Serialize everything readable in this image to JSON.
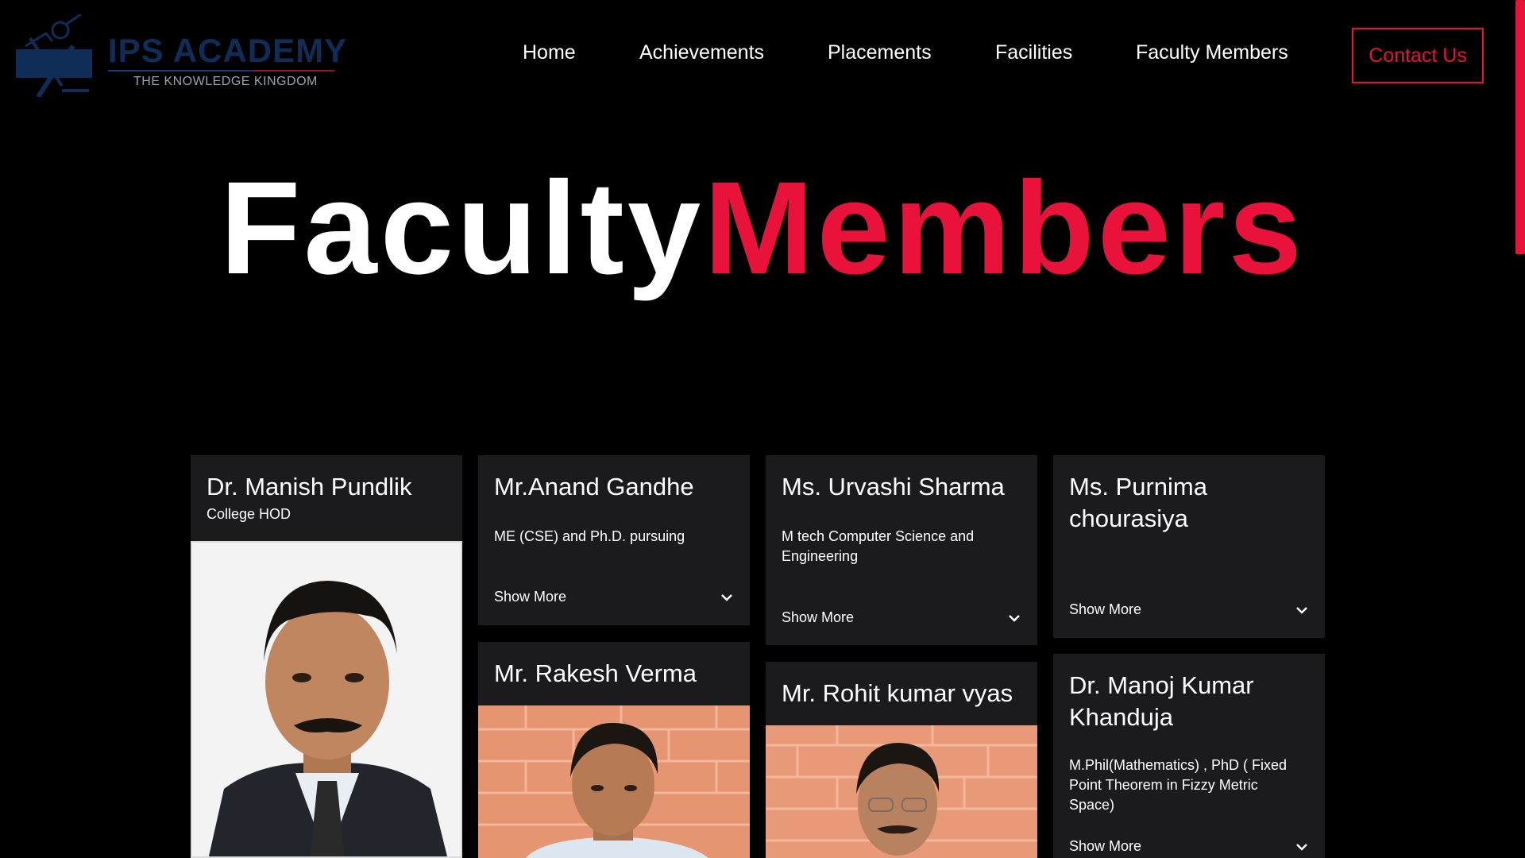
{
  "brand": {
    "title": "IPS ACADEMY",
    "tagline": "THE KNOWLEDGE KINGDOM"
  },
  "nav": {
    "items": [
      "Home",
      "Achievements",
      "Placements",
      "Facilities",
      "Faculty Members"
    ],
    "contact_label": "Contact Us"
  },
  "hero": {
    "word1": "Faculty",
    "word2": "Members"
  },
  "faculty": [
    {
      "name": "Dr. Manish Pundlik",
      "role": "College HOD"
    },
    {
      "name": "Mr.Anand Gandhe",
      "qualification": "ME (CSE) and Ph.D. pursuing",
      "show_more": "Show More"
    },
    {
      "name": "Ms. Urvashi Sharma",
      "qualification": "M tech Computer Science and Engineering",
      "show_more": "Show More"
    },
    {
      "name": "Ms. Purnima chourasiya",
      "show_more": "Show More"
    },
    {
      "name": "Mr. Rakesh Verma"
    },
    {
      "name": "Mr. Rohit kumar vyas"
    },
    {
      "name": "Dr. Manoj Kumar Khanduja",
      "qualification": "M.Phil(Mathematics) , PhD ( Fixed Point Theorem in Fizzy Metric Space)",
      "show_more": "Show More"
    }
  ],
  "colors": {
    "accent": "#e8123a",
    "card_bg": "#1b1b1d",
    "brand_blue": "#0f2d57"
  },
  "icons": {
    "chevron": "chevron-down-icon",
    "logo": "ips-logo-icon"
  }
}
